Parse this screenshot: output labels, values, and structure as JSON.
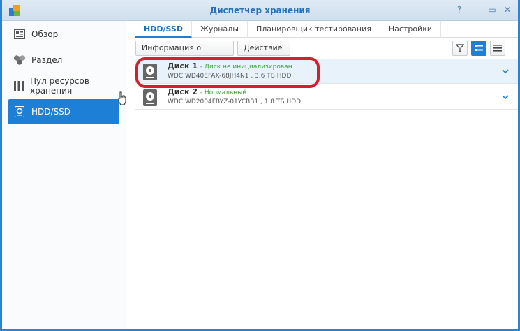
{
  "window": {
    "title": "Диспетчер хранения"
  },
  "window_controls": [
    "?",
    "–",
    "▭",
    "✕"
  ],
  "sidebar": {
    "items": [
      {
        "label": "Обзор",
        "icon": "overview-icon"
      },
      {
        "label": "Раздел",
        "icon": "volume-icon"
      },
      {
        "label": "Пул ресурсов хранения",
        "icon": "storage-pool-icon"
      },
      {
        "label": "HDD/SSD",
        "icon": "hdd-icon",
        "active": true
      }
    ]
  },
  "tabs": [
    {
      "label": "HDD/SSD",
      "active": true
    },
    {
      "label": "Журналы"
    },
    {
      "label": "Планировщик тестирования"
    },
    {
      "label": "Настройки"
    }
  ],
  "toolbar": {
    "info_label": "Информация о состоянии",
    "action_label": "Действие"
  },
  "disks": [
    {
      "name": "Диск 1",
      "status": "- Диск не инициализирован",
      "detail": "WDC WD40EFAX-68JH4N1 , 3.6 ТБ HDD",
      "selected": true
    },
    {
      "name": "Диск 2",
      "status": "- Нормальный",
      "detail": "WDC WD2004FBYZ-01YCBB1 , 1.8 ТБ HDD",
      "selected": false
    }
  ],
  "colors": {
    "accent": "#1e7fd6",
    "status_ok": "#3aa33a",
    "annotation": "#d0212e"
  }
}
